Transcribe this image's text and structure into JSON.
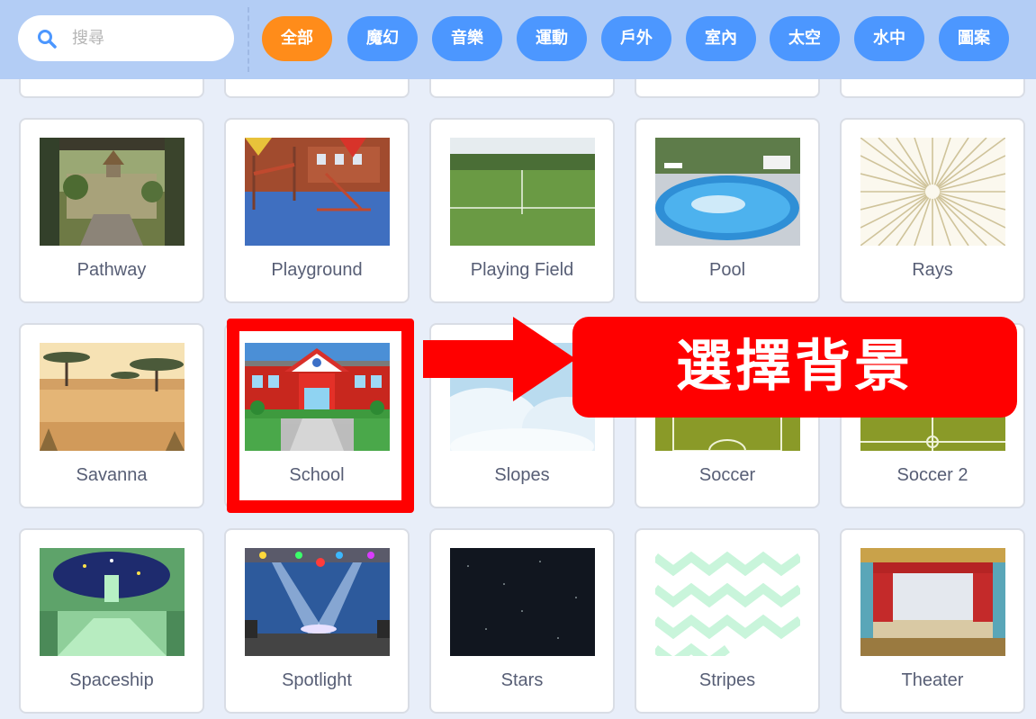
{
  "search": {
    "placeholder": "搜尋",
    "icon": "search-icon"
  },
  "categories": [
    {
      "label": "全部",
      "active": true
    },
    {
      "label": "魔幻"
    },
    {
      "label": "音樂"
    },
    {
      "label": "運動"
    },
    {
      "label": "戶外"
    },
    {
      "label": "室內"
    },
    {
      "label": "太空"
    },
    {
      "label": "水中"
    },
    {
      "label": "圖案"
    }
  ],
  "backdrops": [
    "Pathway",
    "Playground",
    "Playing Field",
    "Pool",
    "Rays",
    "Savanna",
    "School",
    "Slopes",
    "Soccer",
    "Soccer 2",
    "Spaceship",
    "Spotlight",
    "Stars",
    "Stripes",
    "Theater"
  ],
  "annotation": {
    "text": "選擇背景",
    "highlighted": "School"
  },
  "colors": {
    "accent": "#4c97ff",
    "active": "#ff8c1a",
    "highlight": "#ff0000"
  }
}
